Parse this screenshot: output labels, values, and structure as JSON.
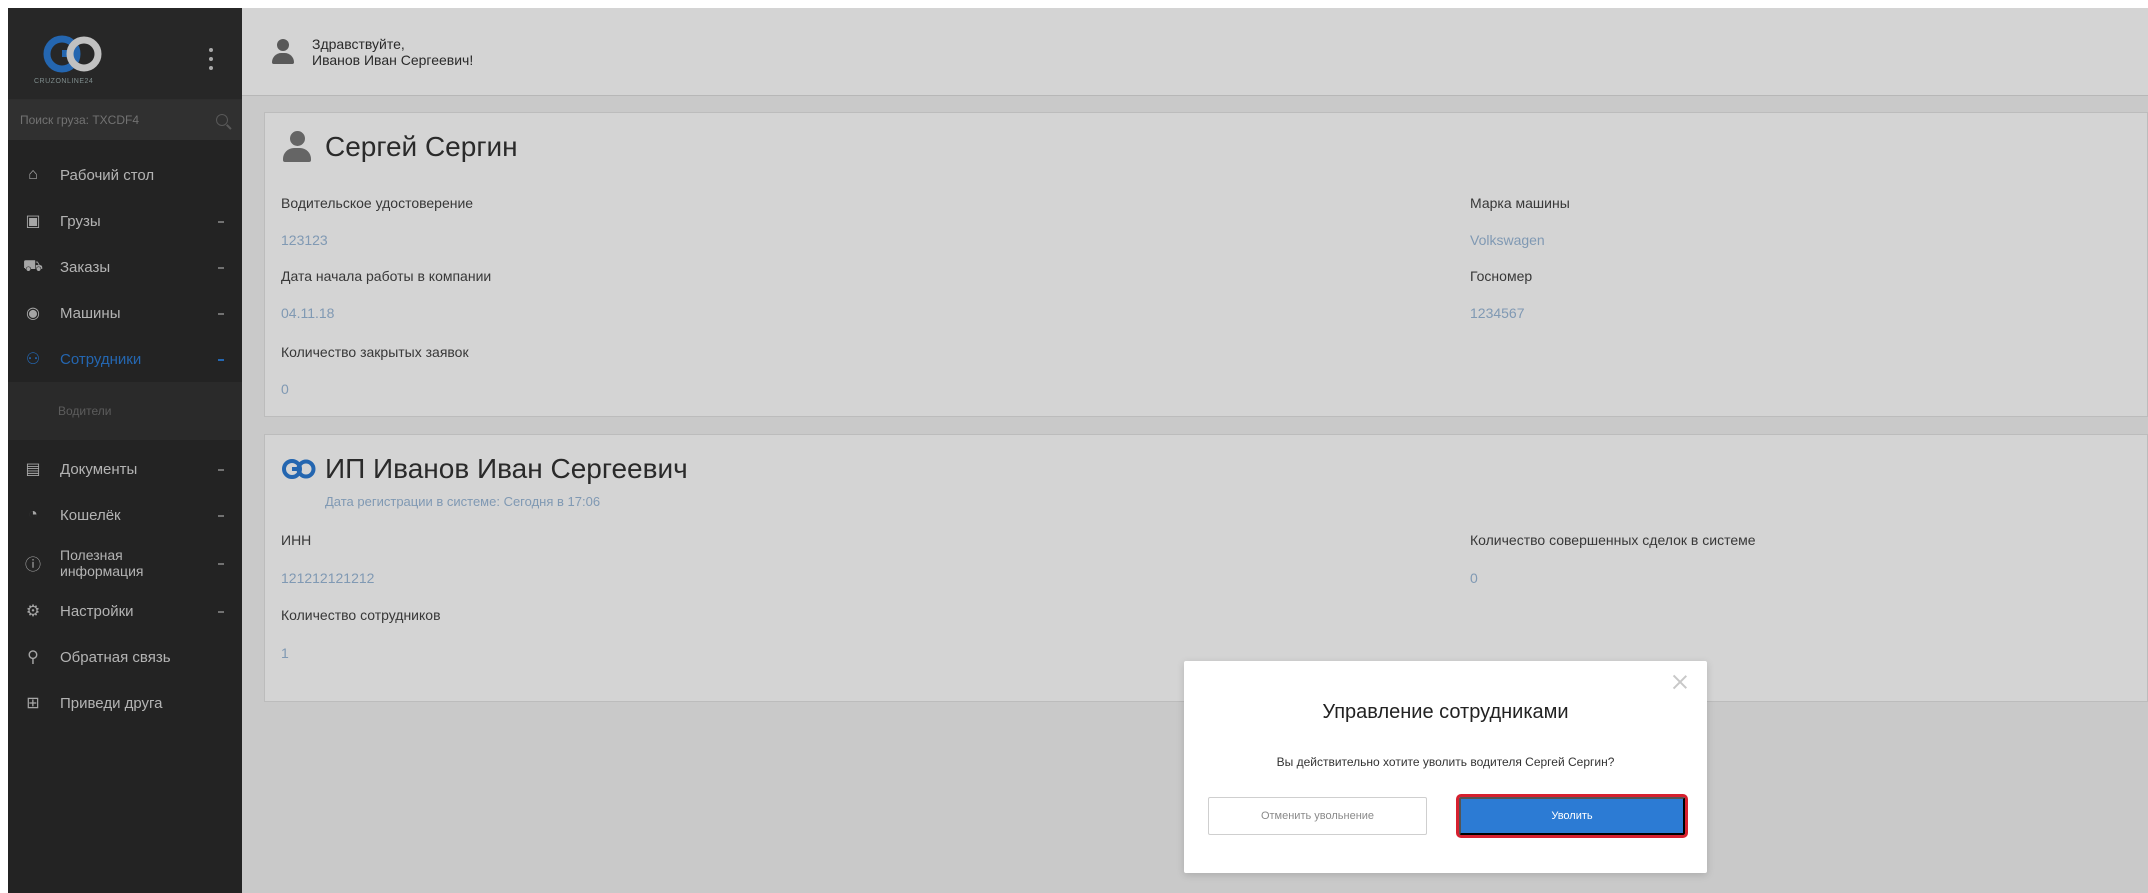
{
  "sidebar": {
    "logo_small_text": "CRUZONLINE24",
    "search_text": "Поиск груза: TXCDF4",
    "items": [
      {
        "label": "Рабочий стол",
        "icon": "home-icon",
        "has_chevron": false
      },
      {
        "label": "Грузы",
        "icon": "box-icon",
        "has_chevron": true
      },
      {
        "label": "Заказы",
        "icon": "truck-icon",
        "has_chevron": true
      },
      {
        "label": "Машины",
        "icon": "wheel-icon",
        "has_chevron": true
      },
      {
        "label": "Сотрудники",
        "icon": "people-icon",
        "has_chevron": true,
        "active": true
      }
    ],
    "sub_item": "Водители",
    "items2": [
      {
        "label": "Документы",
        "icon": "document-icon",
        "has_chevron": true
      },
      {
        "label": "Кошелёк",
        "icon": "wallet-icon",
        "has_chevron": true
      },
      {
        "label": "Полезная информация",
        "icon": "info-icon",
        "has_chevron": true
      },
      {
        "label": "Настройки",
        "icon": "settings-icon",
        "has_chevron": true
      },
      {
        "label": "Обратная связь",
        "icon": "feedback-icon",
        "has_chevron": false
      },
      {
        "label": "Приведи друга",
        "icon": "gift-icon",
        "has_chevron": false
      }
    ],
    "useful_line1": "Полезная",
    "useful_line2": "информация"
  },
  "greeting": {
    "line1": "Здравствуйте,",
    "line2": "Иванов Иван Сергеевич!"
  },
  "driver_card": {
    "name": "Сергей Сергин",
    "license_label": "Водительское удостоверение",
    "license_value": "123123",
    "start_label": "Дата начала работы в компании",
    "start_value": "04.11.18",
    "closed_label": "Количество закрытых заявок",
    "closed_value": "0",
    "car_label": "Марка машины",
    "car_value": "Volkswagen",
    "plate_label": "Госномер",
    "plate_value": "1234567"
  },
  "company_card": {
    "name": "ИП Иванов Иван Сергеевич",
    "reg_date": "Дата регистрации в системе: Сегодня в 17:06",
    "inn_label": "ИНН",
    "inn_value": "121212121212",
    "staff_label": "Количество сотрудников",
    "staff_value": "1",
    "deals_label": "Количество совершенных сделок в системе",
    "deals_value": "0"
  },
  "modal": {
    "title": "Управление сотрудниками",
    "text": "Вы действительно хотите уволить водителя Сергей Сергин?",
    "cancel_label": "Отменить увольнение",
    "confirm_label": "Уволить"
  },
  "colors": {
    "accent": "#2c7bd4",
    "highlight": "#d6202f",
    "sidebar_bg": "#2b2b2b"
  }
}
